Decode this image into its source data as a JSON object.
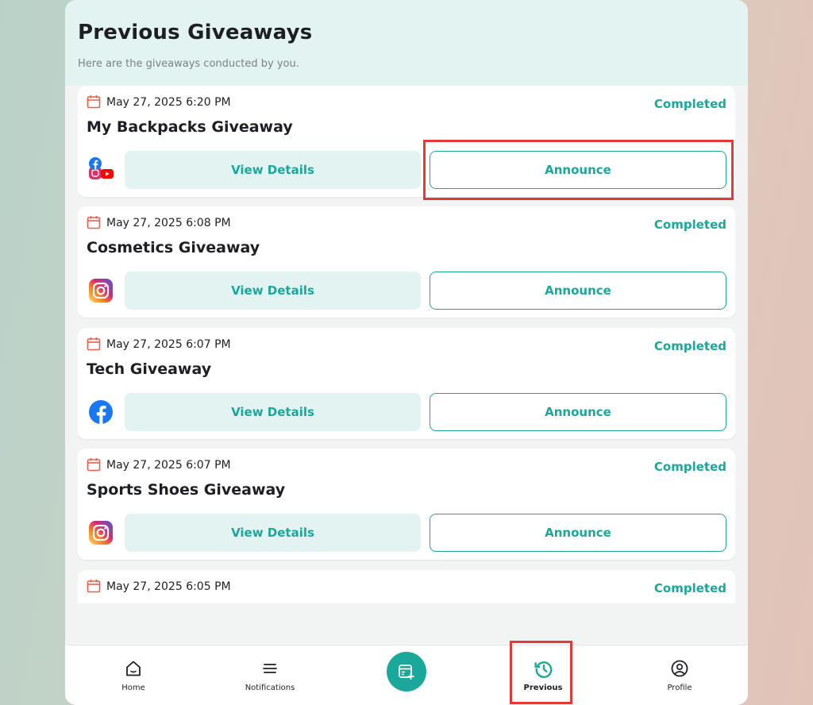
{
  "header": {
    "title": "Previous Giveaways",
    "subtitle": "Here are the giveaways conducted by you."
  },
  "giveaways": [
    {
      "date": "May 27, 2025 6:20 PM",
      "title": "My Backpacks Giveaway",
      "status": "Completed",
      "platforms": [
        "facebook",
        "instagram",
        "youtube"
      ],
      "view_label": "View Details",
      "announce_label": "Announce"
    },
    {
      "date": "May 27, 2025 6:08 PM",
      "title": "Cosmetics Giveaway",
      "status": "Completed",
      "platforms": [
        "instagram"
      ],
      "view_label": "View Details",
      "announce_label": "Announce"
    },
    {
      "date": "May 27, 2025 6:07 PM",
      "title": "Tech Giveaway",
      "status": "Completed",
      "platforms": [
        "facebook"
      ],
      "view_label": "View Details",
      "announce_label": "Announce"
    },
    {
      "date": "May 27, 2025 6:07 PM",
      "title": "Sports Shoes Giveaway",
      "status": "Completed",
      "platforms": [
        "instagram"
      ],
      "view_label": "View Details",
      "announce_label": "Announce"
    },
    {
      "date": "May 27, 2025 6:05 PM",
      "status": "Completed"
    }
  ],
  "nav": {
    "home": "Home",
    "notifications": "Notifications",
    "previous": "Previous",
    "profile": "Profile",
    "active": "previous"
  },
  "colors": {
    "accent": "#1aa89b",
    "header_bg": "#e3f3f1",
    "calendar": "#e8604c",
    "highlight": "#e53935"
  }
}
